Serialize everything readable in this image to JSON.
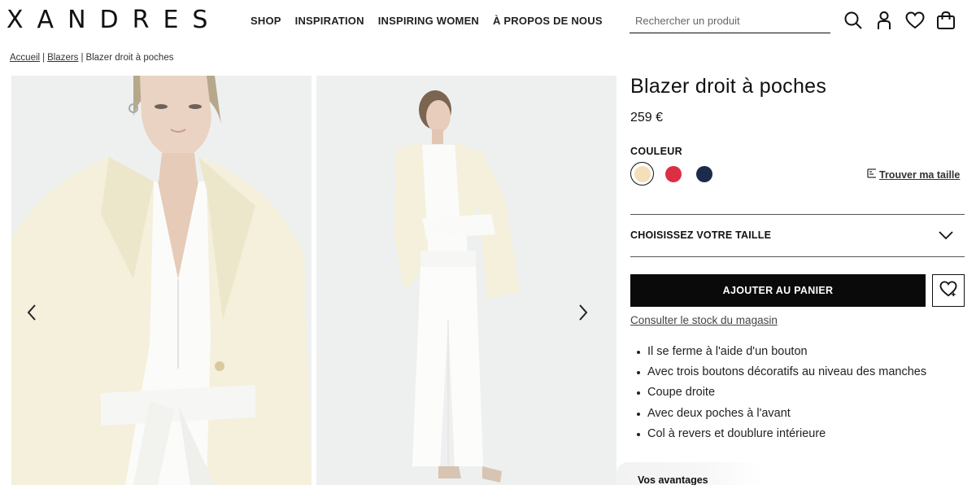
{
  "header": {
    "logo": "XANDRES",
    "nav": [
      "SHOP",
      "INSPIRATION",
      "INSPIRING WOMEN",
      "À PROPOS DE NOUS"
    ],
    "search_placeholder": "Rechercher un produit",
    "icons": [
      "search-icon",
      "account-icon",
      "wishlist-icon",
      "cart-icon"
    ]
  },
  "breadcrumb": {
    "items": [
      "Accueil",
      "Blazers",
      "Blazer droit à poches"
    ]
  },
  "product": {
    "title": "Blazer droit à poches",
    "price": "259 €",
    "color_label": "COULEUR",
    "colors": [
      {
        "name": "cream",
        "hex": "#f5dfb8",
        "selected": true
      },
      {
        "name": "red",
        "hex": "#dc2f45",
        "selected": false
      },
      {
        "name": "navy",
        "hex": "#1c2a4c",
        "selected": false
      }
    ],
    "size_guide": "Trouver ma taille",
    "size_select": "CHOISISSEZ VOTRE TAILLE",
    "add_to_cart": "AJOUTER AU PANIER",
    "store_stock": "Consulter le stock du magasin",
    "features": [
      "Il se ferme à l'aide d'un bouton",
      "Avec trois boutons décoratifs au niveau des manches",
      "Coupe droite",
      "Avec deux poches à l'avant",
      "Col à revers et doublure intérieure"
    ],
    "advantages": "Vos avantages"
  },
  "colors": {
    "accent": "#0a0a0a",
    "jacket": "#f4f0dc",
    "background": "#eef0f0"
  }
}
